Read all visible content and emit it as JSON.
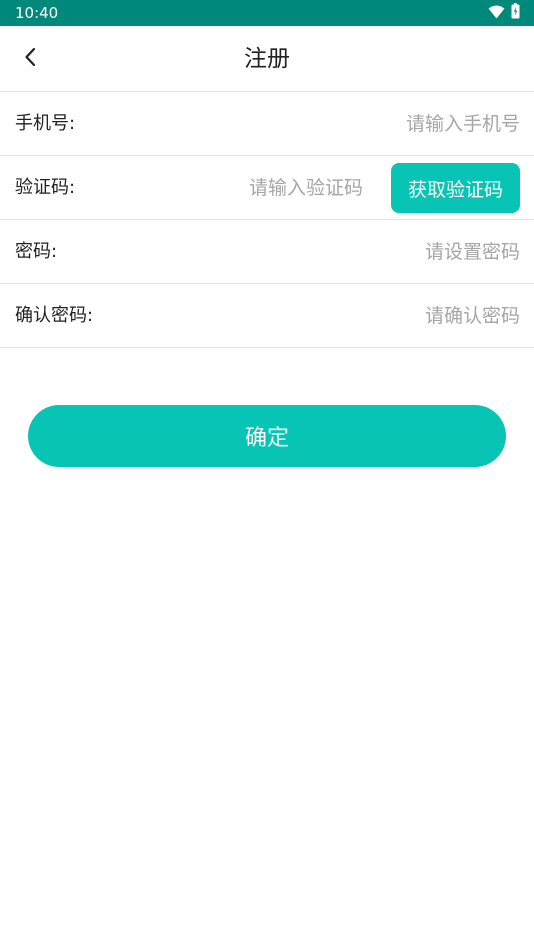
{
  "status_bar": {
    "time": "10:40",
    "icons": [
      "wifi-icon",
      "battery-icon"
    ]
  },
  "header": {
    "back_icon": "chevron-left-icon",
    "title": "注册"
  },
  "form": {
    "phone": {
      "label": "手机号:",
      "placeholder": "请输入手机号",
      "value": ""
    },
    "code": {
      "label": "验证码:",
      "placeholder": "请输入验证码",
      "value": "",
      "button_label": "获取验证码"
    },
    "password": {
      "label": "密码:",
      "placeholder": "请设置密码",
      "value": ""
    },
    "confirm_password": {
      "label": "确认密码:",
      "placeholder": "请确认密码",
      "value": ""
    }
  },
  "submit": {
    "label": "确定"
  },
  "colors": {
    "status_bar": "#00897b",
    "accent": "#08c4b5",
    "placeholder": "#a6a6a6",
    "divider": "#e6e6e6"
  }
}
